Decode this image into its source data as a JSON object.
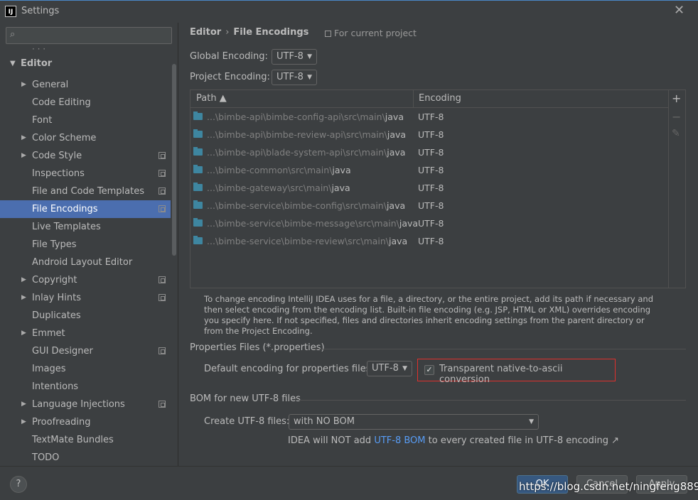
{
  "window": {
    "title": "Settings",
    "app_icon": "IJ"
  },
  "search": {
    "placeholder": ""
  },
  "sidebar": {
    "cut_item": "·  ·  ·",
    "editor_label": "Editor",
    "items": [
      {
        "label": "General",
        "expandable": true,
        "project": false,
        "selected": false
      },
      {
        "label": "Code Editing",
        "expandable": false,
        "project": false,
        "selected": false
      },
      {
        "label": "Font",
        "expandable": false,
        "project": false,
        "selected": false
      },
      {
        "label": "Color Scheme",
        "expandable": true,
        "project": false,
        "selected": false
      },
      {
        "label": "Code Style",
        "expandable": true,
        "project": true,
        "selected": false
      },
      {
        "label": "Inspections",
        "expandable": false,
        "project": true,
        "selected": false
      },
      {
        "label": "File and Code Templates",
        "expandable": false,
        "project": true,
        "selected": false
      },
      {
        "label": "File Encodings",
        "expandable": false,
        "project": true,
        "selected": true
      },
      {
        "label": "Live Templates",
        "expandable": false,
        "project": false,
        "selected": false
      },
      {
        "label": "File Types",
        "expandable": false,
        "project": false,
        "selected": false
      },
      {
        "label": "Android Layout Editor",
        "expandable": false,
        "project": false,
        "selected": false
      },
      {
        "label": "Copyright",
        "expandable": true,
        "project": true,
        "selected": false
      },
      {
        "label": "Inlay Hints",
        "expandable": true,
        "project": true,
        "selected": false
      },
      {
        "label": "Duplicates",
        "expandable": false,
        "project": false,
        "selected": false
      },
      {
        "label": "Emmet",
        "expandable": true,
        "project": false,
        "selected": false
      },
      {
        "label": "GUI Designer",
        "expandable": false,
        "project": true,
        "selected": false
      },
      {
        "label": "Images",
        "expandable": false,
        "project": false,
        "selected": false
      },
      {
        "label": "Intentions",
        "expandable": false,
        "project": false,
        "selected": false
      },
      {
        "label": "Language Injections",
        "expandable": true,
        "project": true,
        "selected": false
      },
      {
        "label": "Proofreading",
        "expandable": true,
        "project": false,
        "selected": false
      },
      {
        "label": "TextMate Bundles",
        "expandable": false,
        "project": false,
        "selected": false
      },
      {
        "label": "TODO",
        "expandable": false,
        "project": false,
        "selected": false
      }
    ]
  },
  "breadcrumb": {
    "parent": "Editor",
    "separator": "›",
    "current": "File Encodings",
    "scope": "For current project"
  },
  "global_encoding": {
    "label": "Global Encoding:",
    "value": "UTF-8"
  },
  "project_encoding": {
    "label": "Project Encoding:",
    "value": "UTF-8"
  },
  "table": {
    "col_path": "Path ▲",
    "col_encoding": "Encoding",
    "rows": [
      {
        "prefix": "...\\bimbe-api\\bimbe-config-api\\src\\main\\",
        "last": "java",
        "encoding": "UTF-8"
      },
      {
        "prefix": "...\\bimbe-api\\bimbe-review-api\\src\\main\\",
        "last": "java",
        "encoding": "UTF-8"
      },
      {
        "prefix": "...\\bimbe-api\\blade-system-api\\src\\main\\",
        "last": "java",
        "encoding": "UTF-8"
      },
      {
        "prefix": "...\\bimbe-common\\src\\main\\",
        "last": "java",
        "encoding": "UTF-8"
      },
      {
        "prefix": "...\\bimbe-gateway\\src\\main\\",
        "last": "java",
        "encoding": "UTF-8"
      },
      {
        "prefix": "...\\bimbe-service\\bimbe-config\\src\\main\\",
        "last": "java",
        "encoding": "UTF-8"
      },
      {
        "prefix": "...\\bimbe-service\\bimbe-message\\src\\main\\",
        "last": "java",
        "encoding": "UTF-8"
      },
      {
        "prefix": "...\\bimbe-service\\bimbe-review\\src\\main\\",
        "last": "java",
        "encoding": "UTF-8"
      }
    ],
    "tools": {
      "add": "+",
      "remove": "−",
      "edit": "✎"
    }
  },
  "help_text": "To change encoding IntelliJ IDEA uses for a file, a directory, or the entire project, add its path if necessary and then select encoding from the encoding list. Built-in file encoding (e.g. JSP, HTML or XML) overrides encoding you specify here. If not specified, files and directories inherit encoding settings from the parent directory or from the Project Encoding.",
  "properties": {
    "section": "Properties Files (*.properties)",
    "default_label": "Default encoding for properties files:",
    "default_value": "UTF-8",
    "native_ascii_label": "Transparent native-to-ascii conversion",
    "native_ascii_checked": true,
    "highlight_color": "#e0302c"
  },
  "bom": {
    "section": "BOM for new UTF-8 files",
    "create_label": "Create UTF-8 files:",
    "create_value": "with NO BOM",
    "note_prefix": "IDEA will NOT add ",
    "note_link": "UTF-8 BOM",
    "note_suffix": " to every created file in UTF-8 encoding ↗"
  },
  "footer": {
    "help": "?",
    "ok": "OK",
    "cancel": "Cancel",
    "apply": "Apply",
    "watermark": "https://blog.csdn.net/ningfeng8899"
  }
}
